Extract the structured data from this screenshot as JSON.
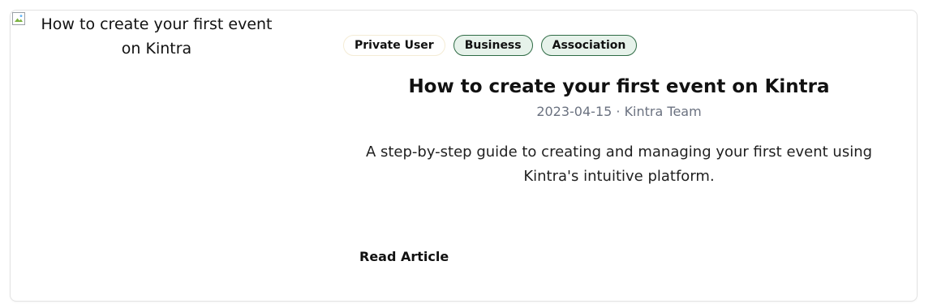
{
  "article": {
    "image_alt": "How to create your first event on Kintra",
    "tags": [
      "Private User",
      "Business",
      "Association"
    ],
    "title": "How to create your first event on Kintra",
    "date": "2023-04-15",
    "separator": " · ",
    "author": "Kintra Team",
    "description": "A step-by-step guide to creating and managing your first event using Kintra's intuitive platform.",
    "read_label": "Read Article"
  },
  "colors": {
    "tag_green_bg": "#e6f2ea",
    "tag_green_border": "#2f6b45",
    "meta_text": "#6b7280",
    "card_border": "#e3e3e3"
  },
  "icons": {
    "image_placeholder": "broken-image-icon"
  }
}
